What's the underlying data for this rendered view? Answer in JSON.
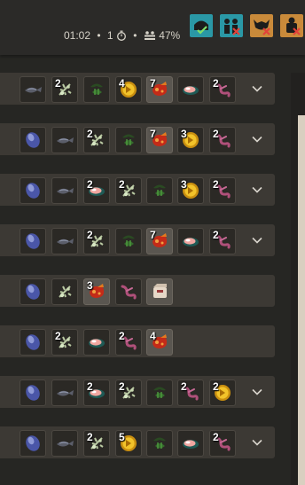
{
  "status_bar": {
    "time": "01:02",
    "dot1": "•",
    "timer_count": "1",
    "dot2": "•",
    "players_pct": "47%"
  },
  "filters": [
    {
      "name": "filter-bag-checked",
      "icon": "bag-icon",
      "state": "checked",
      "color": "#2a98a6"
    },
    {
      "name": "filter-people-unchecked",
      "icon": "people-icon",
      "state": "crossed",
      "color": "#2a98a6"
    },
    {
      "name": "filter-boss-crossed",
      "icon": "boss-icon",
      "state": "crossed",
      "color": "#c98a3a"
    },
    {
      "name": "filter-raid-crossed",
      "icon": "raid-icon",
      "state": "crossed",
      "color": "#c98a3a"
    }
  ],
  "rows": [
    {
      "has_chevron": true,
      "items": [
        {
          "kind": "fish",
          "count": ""
        },
        {
          "kind": "seed",
          "count": "2"
        },
        {
          "kind": "leaf",
          "count": ""
        },
        {
          "kind": "coin",
          "count": "4"
        },
        {
          "kind": "meat",
          "count": "7",
          "highlight": true
        },
        {
          "kind": "salmon",
          "count": ""
        },
        {
          "kind": "worm",
          "count": "2"
        }
      ]
    },
    {
      "has_chevron": true,
      "items": [
        {
          "kind": "egg",
          "count": ""
        },
        {
          "kind": "fish",
          "count": ""
        },
        {
          "kind": "seed",
          "count": "2"
        },
        {
          "kind": "leaf",
          "count": ""
        },
        {
          "kind": "meat",
          "count": "7",
          "highlight": true
        },
        {
          "kind": "coin",
          "count": "3"
        },
        {
          "kind": "worm",
          "count": "2"
        }
      ]
    },
    {
      "has_chevron": true,
      "items": [
        {
          "kind": "egg",
          "count": ""
        },
        {
          "kind": "fish",
          "count": ""
        },
        {
          "kind": "salmon",
          "count": "2"
        },
        {
          "kind": "seed",
          "count": "2"
        },
        {
          "kind": "leaf",
          "count": ""
        },
        {
          "kind": "coin",
          "count": "3"
        },
        {
          "kind": "worm",
          "count": "2"
        }
      ]
    },
    {
      "has_chevron": true,
      "items": [
        {
          "kind": "egg",
          "count": ""
        },
        {
          "kind": "fish",
          "count": ""
        },
        {
          "kind": "seed",
          "count": "2"
        },
        {
          "kind": "leaf",
          "count": ""
        },
        {
          "kind": "meat",
          "count": "7",
          "highlight": true
        },
        {
          "kind": "salmon",
          "count": ""
        },
        {
          "kind": "worm",
          "count": "2"
        }
      ]
    },
    {
      "has_chevron": false,
      "items": [
        {
          "kind": "egg",
          "count": ""
        },
        {
          "kind": "seed",
          "count": ""
        },
        {
          "kind": "meat",
          "count": "3",
          "highlight": true
        },
        {
          "kind": "worm",
          "count": ""
        },
        {
          "kind": "box",
          "count": "",
          "highlight": true
        }
      ]
    },
    {
      "has_chevron": false,
      "items": [
        {
          "kind": "egg",
          "count": ""
        },
        {
          "kind": "seed",
          "count": "2"
        },
        {
          "kind": "salmon",
          "count": ""
        },
        {
          "kind": "worm",
          "count": "2"
        },
        {
          "kind": "meat",
          "count": "4",
          "highlight": true
        }
      ]
    },
    {
      "has_chevron": true,
      "items": [
        {
          "kind": "egg",
          "count": ""
        },
        {
          "kind": "fish",
          "count": ""
        },
        {
          "kind": "salmon",
          "count": "2"
        },
        {
          "kind": "seed",
          "count": "2"
        },
        {
          "kind": "leaf",
          "count": ""
        },
        {
          "kind": "worm",
          "count": "2"
        },
        {
          "kind": "coin",
          "count": "2"
        }
      ]
    },
    {
      "has_chevron": true,
      "items": [
        {
          "kind": "egg",
          "count": ""
        },
        {
          "kind": "fish",
          "count": ""
        },
        {
          "kind": "seed",
          "count": "2"
        },
        {
          "kind": "coin",
          "count": "5"
        },
        {
          "kind": "leaf",
          "count": ""
        },
        {
          "kind": "salmon",
          "count": ""
        },
        {
          "kind": "worm",
          "count": "2"
        }
      ]
    }
  ]
}
